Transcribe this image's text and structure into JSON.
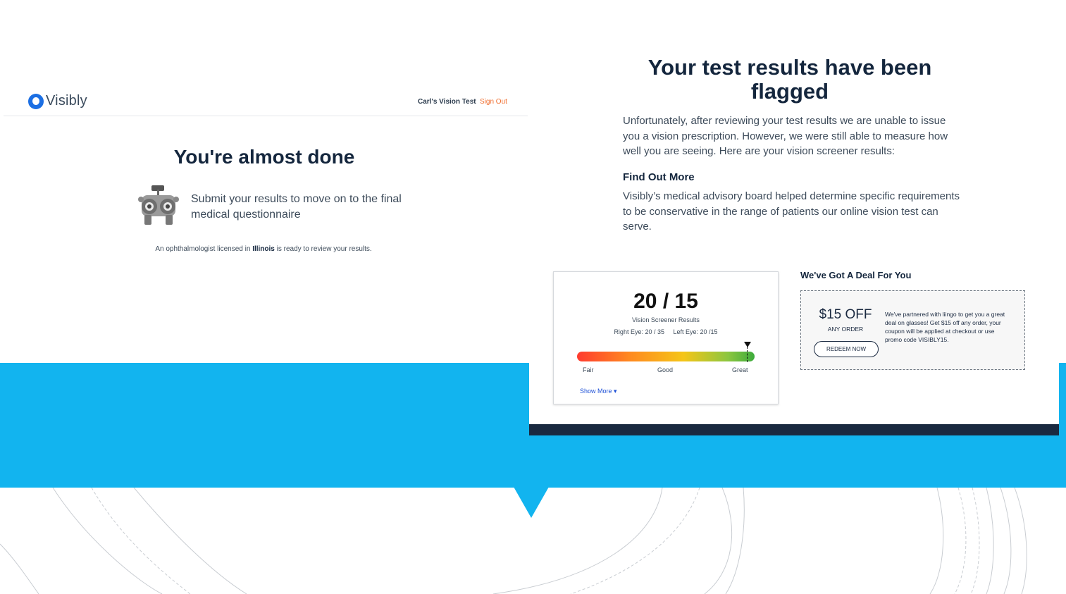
{
  "left_screen": {
    "logo_text": "Visibly",
    "user_label": "Carl's Vision Test",
    "sign_out_label": "Sign Out",
    "title": "You're almost done",
    "submit_text": "Submit your results to move on to the final medical questionnaire",
    "review_note_prefix": "An ophthalmologist licensed in ",
    "review_note_state": "Illinois",
    "review_note_suffix": " is ready to review your results."
  },
  "right_screen": {
    "title": "Your test results have been flagged",
    "description": "Unfortunately, after reviewing your test results we are unable to issue you a vision prescription. However, we were still able to measure how well you are seeing. Here are your vision screener results:",
    "find_out_heading": "Find Out More",
    "find_out_text": "Visibly’s medical advisory board helped determine specific requirements to be conservative in the range of patients our online vision test can serve.",
    "result_card": {
      "score": "20 / 15",
      "score_label": "Vision Screener Results",
      "right_eye": "Right Eye: 20 / 35",
      "left_eye": "Left Eye: 20 /15",
      "scale_labels": [
        "Fair",
        "Good",
        "Great"
      ],
      "marker_position": 0.96,
      "show_more_label": "Show More ▾"
    },
    "deal": {
      "heading": "We've Got A Deal For You",
      "amount": "$15 OFF",
      "amount_sub": "ANY ORDER",
      "redeem_label": "REDEEM NOW",
      "text": "We've partnered with liingo to get you a great deal on glasses! Get $15 off any order, your coupon will be applied at checkout or use promo code VISIBLY15."
    }
  },
  "colors": {
    "brand_blue": "#12b4ef",
    "navy": "#1a2940",
    "sign_out": "#f06c2c",
    "link_blue": "#1c4fd6"
  }
}
